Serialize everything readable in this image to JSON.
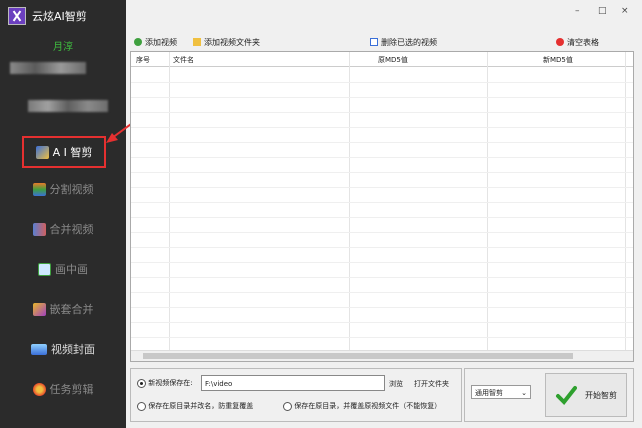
{
  "app": {
    "title": "云炫AI智剪",
    "user": "月淳"
  },
  "sidebar": {
    "items": [
      {
        "label": "A I 智剪",
        "icon": "ai-cut-icon",
        "color": "#3a6fd8"
      },
      {
        "label": "分割视频",
        "icon": "split-video-icon",
        "color": "#e87a2a"
      },
      {
        "label": "合并视频",
        "icon": "merge-video-icon",
        "color": "#5a7fd0"
      },
      {
        "label": "画中画",
        "icon": "picture-in-picture-icon",
        "color": "#3fa03f"
      },
      {
        "label": "嵌套合并",
        "icon": "nested-merge-icon",
        "color": "#e8b82a"
      },
      {
        "label": "视频封面",
        "icon": "video-cover-icon",
        "color": "#3a8fd8"
      },
      {
        "label": "任务剪辑",
        "icon": "task-edit-icon",
        "color": "#e84a2a"
      }
    ]
  },
  "toolbar": {
    "add_video": "添加视频",
    "add_folder": "添加视频文件夹",
    "remove_selected": "删除已选的视频",
    "clear_table": "清空表格"
  },
  "table": {
    "headers": [
      "序号",
      "文件名",
      "原MD5值",
      "新MD5值"
    ]
  },
  "output": {
    "save_label": "新视频保存在:",
    "path": "F:\\video",
    "browse": "浏览",
    "open_folder": "打开文件夹",
    "option_rename": "保存在原目录并改名，防重复覆盖",
    "option_overwrite": "保存在原目录，并覆盖原视频文件（不能恢复）"
  },
  "action": {
    "mode": "通用智剪",
    "start": "开始智剪"
  },
  "window": {
    "minimize": "–",
    "maximize": "□",
    "close": "×"
  }
}
